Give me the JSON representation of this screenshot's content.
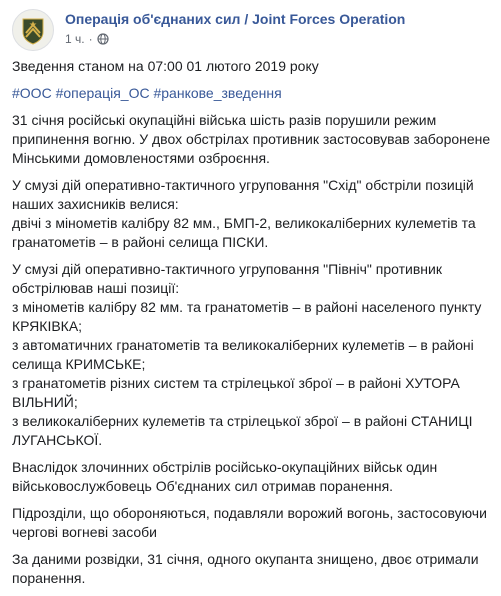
{
  "post": {
    "page_name": "Операція об'єднаних сил / Joint Forces Operation",
    "time": "1 ч.",
    "separator": "·",
    "privacy_icon": "globe-icon",
    "paragraphs": {
      "p1": "Зведення станом на 07:00 01 лютого 2019 року",
      "p3": "31 січня російські окупаційні війська шість разів порушили режим припинення вогню. У двох обстрілах противник застосовував заборонене Мінськими домовленостями озброєння.",
      "p4_l1": "У смузі дій оперативно-тактичного угруповання \"Схід\" обстріли позицій наших захисників велися:",
      "p4_l2": "двічі з мінометів калібру 82 мм., БМП-2, великокаліберних кулеметів та гранатометів – в районі селища ПІСКИ.",
      "p5_l1": "У смузі дій оперативно-тактичного угруповання \"Північ\" противник обстрілював наші позиції:",
      "p5_l2": "з мінометів калібру 82 мм. та гранатометів – в районі населеного пункту КРЯКІВКА;",
      "p5_l3": "з автоматичних гранатометів та великокаліберних кулеметів – в районі селища КРИМСЬКЕ;",
      "p5_l4": "з гранатометів різних систем та стрілецької зброї – в районі ХУТОРА ВІЛЬНИЙ;",
      "p5_l5": "з великокаліберних кулеметів та стрілецької зброї – в районі СТАНИЦІ ЛУГАНСЬКОЇ.",
      "p6": "Внаслідок злочинних обстрілів російсько-окупаційних військ один військовослужбовець Об'єднаних сил отримав поранення.",
      "p7": "Підрозділи, що обороняються, подавляли ворожий вогонь, застосовуючи чергові вогневі засоби",
      "p8": "За даними розвідки, 31 січня, одного окупанта знищено, двоє отримали поранення."
    },
    "hashtags": [
      "#ООС",
      "#операція_ОС",
      "#ранкове_зведення"
    ],
    "colors": {
      "link": "#385898",
      "text": "#1c1e21",
      "meta": "#616770",
      "logo_green": "#3a4a2a",
      "logo_gold": "#d6b24a"
    }
  }
}
